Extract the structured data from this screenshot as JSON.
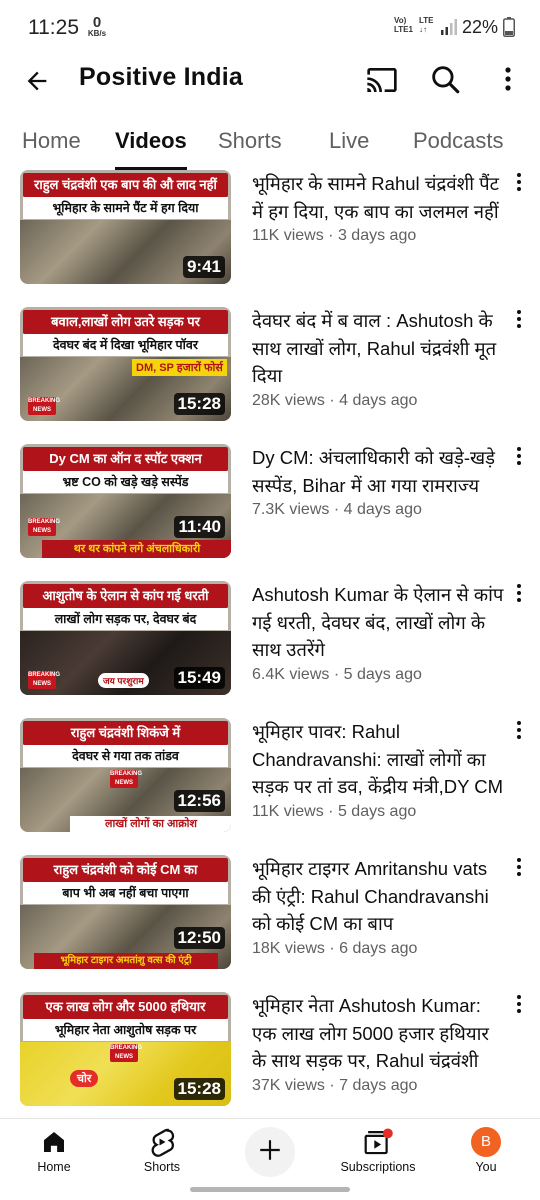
{
  "status_bar": {
    "time": "11:25",
    "data_rate": "0",
    "data_unit": "KB/s",
    "volte": "Vo)",
    "lte1": "LTE1",
    "lte": "LTE",
    "lte_arrows": "↓↑",
    "battery": "22%"
  },
  "app_bar": {
    "title": "Positive India",
    "icons": [
      "back-arrow-icon",
      "cast-icon",
      "search-icon",
      "more-vert-icon"
    ]
  },
  "tabs": [
    {
      "label": "Home"
    },
    {
      "label": "Videos",
      "active": true
    },
    {
      "label": "Shorts"
    },
    {
      "label": "Live"
    },
    {
      "label": "Podcasts"
    }
  ],
  "videos": [
    {
      "thumb_line1": "राहुल चंद्रवंशी एक बाप की औ लाद नहीं",
      "thumb_line2": "भूमिहार के सामने पैंट में हग दिया",
      "duration": "9:41",
      "title": "भूमिहार के सामने Rahul चंद्रवंशी पैंट में हग दिया, एक बाप का जलमल नहीं",
      "views": "11K views",
      "age": "3 days ago"
    },
    {
      "thumb_line1": "बवाल,लाखों लोग उतरे सड़क पर",
      "thumb_line2": "देवघर बंद में दिखा भूमिहार पॉवर",
      "thumb_extra": "DM, SP हजारों फोर्स",
      "badge": "BREAKING NEWS",
      "duration": "15:28",
      "title": "देवघर बंद में ब वाल : Ashutosh के साथ लाखों लोग, Rahul चंद्रवंशी मूत दिया",
      "views": "28K views",
      "age": "4 days ago"
    },
    {
      "thumb_line1": "Dy CM का ऑन द स्पॉट एक्शन",
      "thumb_line2": "भ्रष्ट CO को खड़े खड़े सस्पेंड",
      "thumb_extra": "थर थर कांपने लगे अंचलाधिकारी",
      "badge": "BREAKING NEWS",
      "duration": "11:40",
      "title": "Dy CM: अंचलाधिकारी को खड़े-खड़े सस्पेंड, Bihar में आ गया रामराज्य",
      "views": "7.3K views",
      "age": "4 days ago"
    },
    {
      "thumb_line1": "आशुतोष के ऐलान से कांप गई धरती",
      "thumb_line2": "लाखों लोग सड़क पर, देवघर बंद",
      "thumb_extra": "जय परशुराम",
      "badge": "BREAKING NEWS",
      "duration": "15:49",
      "title": "Ashutosh Kumar के ऐलान से कांप गई धरती, देवघर बंद, लाखों लोग के साथ उतरेंगे",
      "views": "6.4K views",
      "age": "5 days ago"
    },
    {
      "thumb_line1": "राहुल चंद्रवंशी शिकंजे में",
      "thumb_line2": "देवघर से गया तक तांडव",
      "thumb_extra": "लाखों लोगों का आक्रोश",
      "badge": "BREAKING NEWS",
      "duration": "12:56",
      "title": "भूमिहार पावर: Rahul Chandravanshi: लाखों लोगों का सड़क पर तां डव, केंद्रीय मंत्री,DY CM",
      "views": "11K views",
      "age": "5 days ago"
    },
    {
      "thumb_line1": "राहुल चंद्रवंशी को कोई CM का",
      "thumb_line2": "बाप भी अब नहीं बचा पाएगा",
      "thumb_extra": "भूमिहार टाइगर अमतांशु वत्स की एंट्री",
      "duration": "12:50",
      "title": "भूमिहार टाइगर Amritanshu vats की एंट्री: Rahul Chandravanshi को कोई CM का बाप",
      "views": "18K views",
      "age": "6 days ago"
    },
    {
      "thumb_line1": "एक लाख लोग और 5000 हथियार",
      "thumb_line2": "भूमिहार नेता आशुतोष सड़क पर",
      "thumb_extra": "चोर",
      "badge": "BREAKING NEWS",
      "duration": "15:28",
      "title": "भूमिहार नेता Ashutosh Kumar: एक लाख लोग 5000 हजार हथियार के साथ सड़क पर, Rahul चंद्रवंशी",
      "views": "37K views",
      "age": "7 days ago"
    }
  ],
  "views_separator": " · ",
  "bottom_nav": {
    "home": "Home",
    "shorts": "Shorts",
    "subscriptions": "Subscriptions",
    "you": "You",
    "avatar_letter": "B"
  },
  "colors": {
    "accent_red": "#b0141a",
    "avatar": "#f26322",
    "notification_dot": "#e52d27"
  }
}
